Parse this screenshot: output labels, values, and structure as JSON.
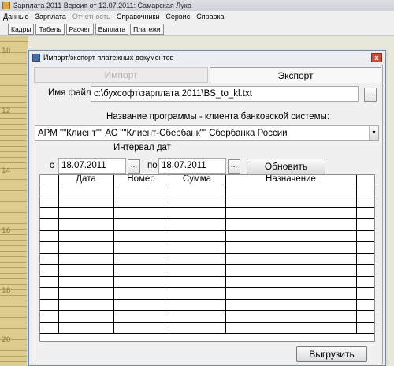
{
  "window": {
    "title": "Зарплата 2011 Версия от 12.07.2011: Самарская Лука"
  },
  "menu": [
    {
      "label": "Данные",
      "disabled": false
    },
    {
      "label": "Зарплата",
      "disabled": false
    },
    {
      "label": "Отчетность",
      "disabled": true
    },
    {
      "label": "Справочники",
      "disabled": false
    },
    {
      "label": "Сервис",
      "disabled": false
    },
    {
      "label": "Справка",
      "disabled": false
    }
  ],
  "toolbar": [
    "Кадры",
    "Табель",
    "Расчет",
    "Выплата",
    "Платежи"
  ],
  "ruler": [
    "10",
    "12",
    "14",
    "16",
    "18",
    "20"
  ],
  "dialog": {
    "title": "Импорт/экспорт платежных документов",
    "close": "x",
    "tabs": {
      "import": "Импорт",
      "export": "Экспорт"
    },
    "file_label": "Имя файла",
    "file_value": "c:\\бухсофт\\зарплата 2011\\BS_to_kl.txt",
    "ellipsis": "...",
    "program_label": "Название программы - клиента банковской системы:",
    "program_value": "АРМ \"\"Клиент\"\" АС \"\"Клиент-Сбербанк\"\" Сбербанка России",
    "interval_label": "Интервал дат",
    "from_label": "с",
    "from_value": "18.07.2011",
    "to_label": "по",
    "to_value": "18.07.2011",
    "refresh_button": "Обновить",
    "columns": [
      "Дата",
      "Номер",
      "Сумма",
      "Назначение"
    ],
    "rows": 13,
    "upload_button": "Выгрузить"
  }
}
